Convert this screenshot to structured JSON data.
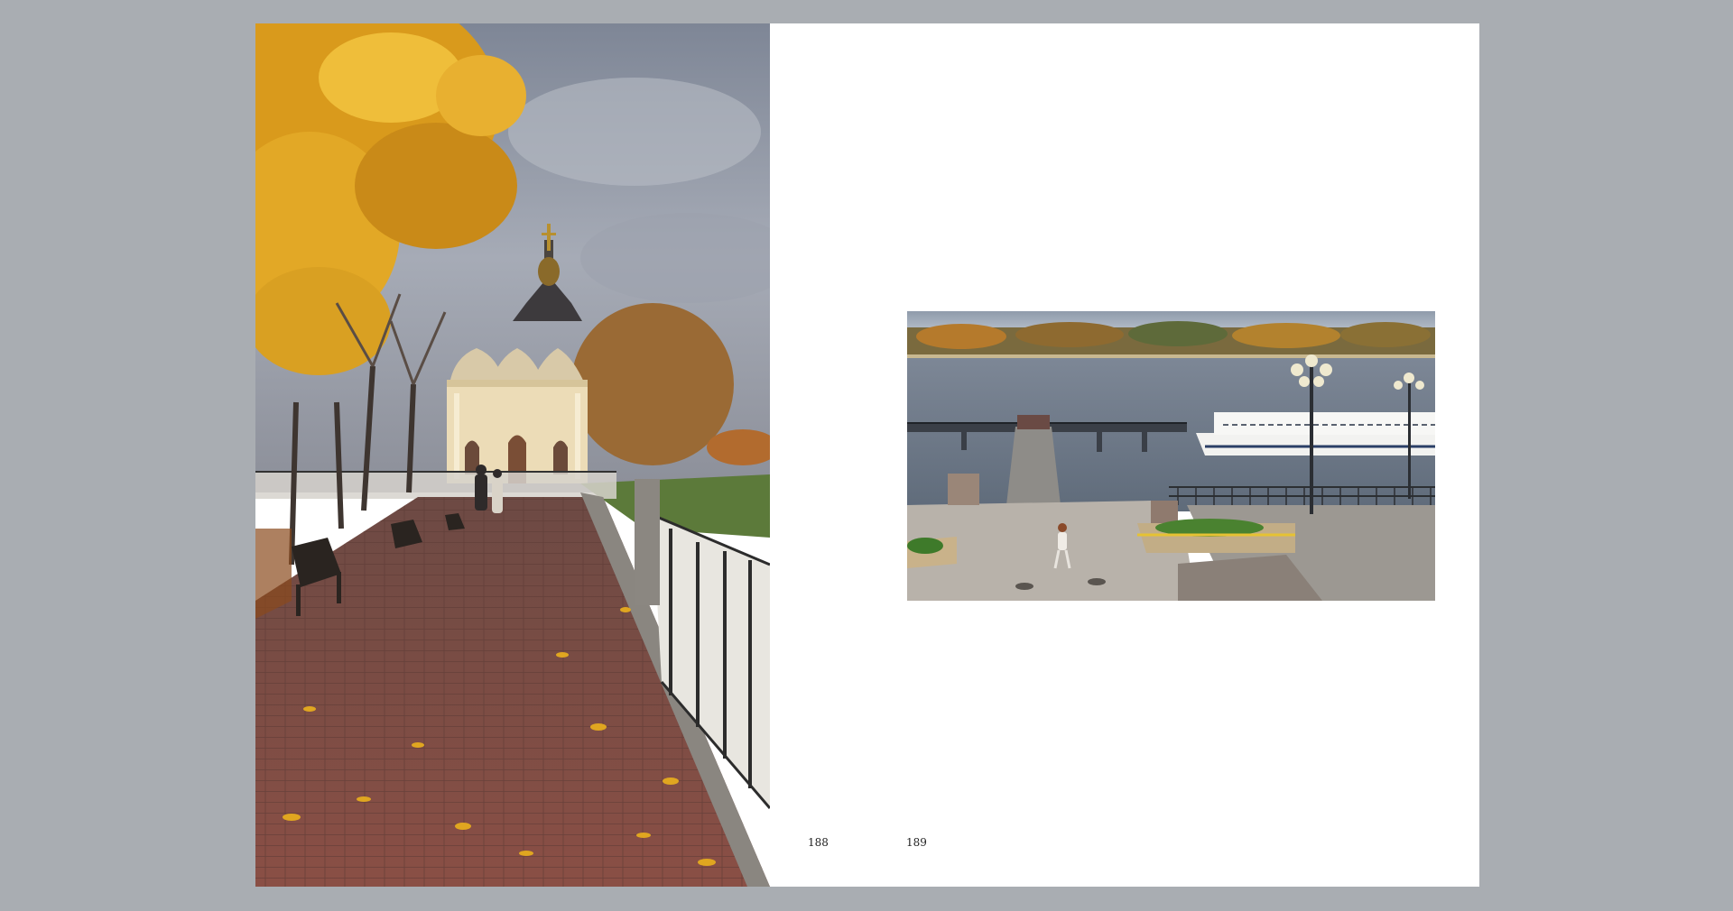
{
  "book": {
    "left_page": {
      "page_number": "188",
      "photo": {
        "subject": "autumn-embankment-with-chapel"
      }
    },
    "right_page": {
      "page_number": "189",
      "photo": {
        "subject": "river-pier-with-boat"
      }
    }
  },
  "colors": {
    "background": "#a9adb2",
    "page": "#ffffff",
    "gutter_line": "#3a3a3a"
  }
}
